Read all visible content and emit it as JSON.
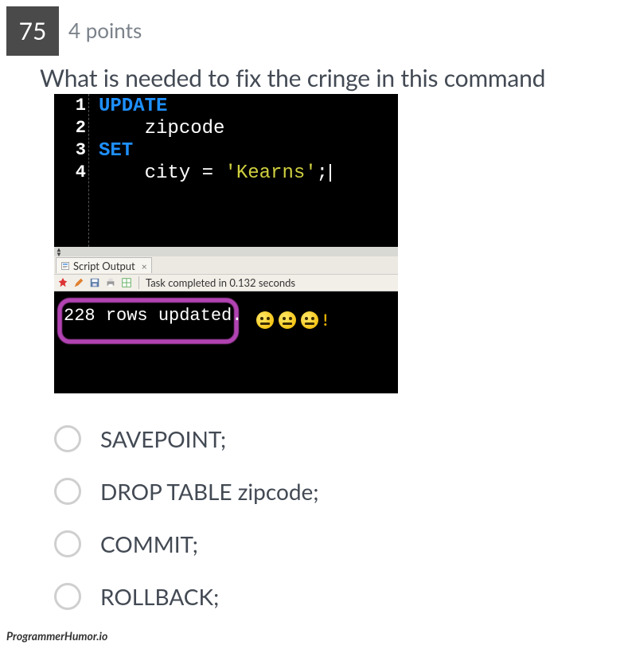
{
  "question": {
    "number": "75",
    "points": "4 points",
    "prompt": "What is needed to fix the cringe in this command"
  },
  "code": {
    "lines": [
      {
        "n": "1",
        "tokens": [
          {
            "t": "UPDATE",
            "c": "kw"
          }
        ]
      },
      {
        "n": "2",
        "tokens": [
          {
            "t": "    zipcode",
            "c": "ident"
          }
        ]
      },
      {
        "n": "3",
        "tokens": [
          {
            "t": "SET",
            "c": "kw"
          }
        ]
      },
      {
        "n": "4",
        "tokens": [
          {
            "t": "    city ",
            "c": "ident"
          },
          {
            "t": "= ",
            "c": "op"
          },
          {
            "t": "'Kearns'",
            "c": "str"
          },
          {
            "t": ";",
            "c": "op"
          }
        ]
      }
    ]
  },
  "output_panel": {
    "tab_label": "Script Output",
    "tab_close": "×",
    "toolbar_icons": [
      "pin-icon",
      "pencil-icon",
      "save-icon",
      "print-icon",
      "grid-icon"
    ],
    "task_message": "Task completed in 0.132 seconds",
    "result_text": "228 rows updated.",
    "reaction_emojis": 3,
    "reaction_suffix": "!"
  },
  "options": [
    {
      "label": "SAVEPOINT;"
    },
    {
      "label": "DROP TABLE zipcode;"
    },
    {
      "label": "COMMIT;"
    },
    {
      "label": "ROLLBACK;"
    }
  ],
  "watermark": "ProgrammerHumor.io"
}
